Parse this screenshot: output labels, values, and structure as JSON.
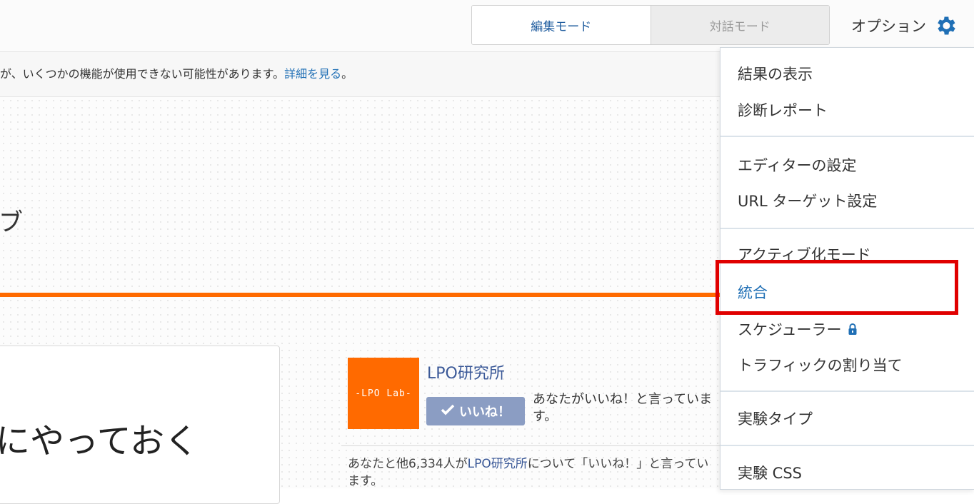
{
  "topbar": {
    "mode_edit": "編集モード",
    "mode_dialog": "対話モード",
    "options_label": "オプション"
  },
  "warning": {
    "text": "が、いくつかの機能が使用できない可能性があります。",
    "link": "詳細を見る",
    "suffix": "。"
  },
  "page": {
    "heading_fragment": "ブ",
    "card_text": "にやっておく"
  },
  "fb_widget": {
    "logo_text": "-LPO Lab-",
    "page_name": "LPO研究所",
    "like_button": "いいね！",
    "liked_text": "あなたがいいね！と言っています。",
    "count_prefix": "あなたと他6,334人が",
    "count_link": "LPO研究所",
    "count_suffix": "について「いいね！」と言っています。"
  },
  "menu": {
    "items": [
      {
        "label": "結果の表示"
      },
      {
        "label": "診断レポート"
      },
      {
        "label": "エディターの設定"
      },
      {
        "label": "URL ターゲット設定"
      },
      {
        "label": "アクティブ化モード"
      },
      {
        "label": "統合",
        "active": true
      },
      {
        "label": "スケジューラー",
        "locked": true
      },
      {
        "label": "トラフィックの割り当て"
      },
      {
        "label": "実験タイプ"
      },
      {
        "label": "実験 CSS"
      }
    ]
  },
  "colors": {
    "accent_orange": "#ff6a00",
    "link_blue": "#1f6fb5",
    "highlight_red": "#e00000",
    "fb_blue": "#3b5998"
  }
}
